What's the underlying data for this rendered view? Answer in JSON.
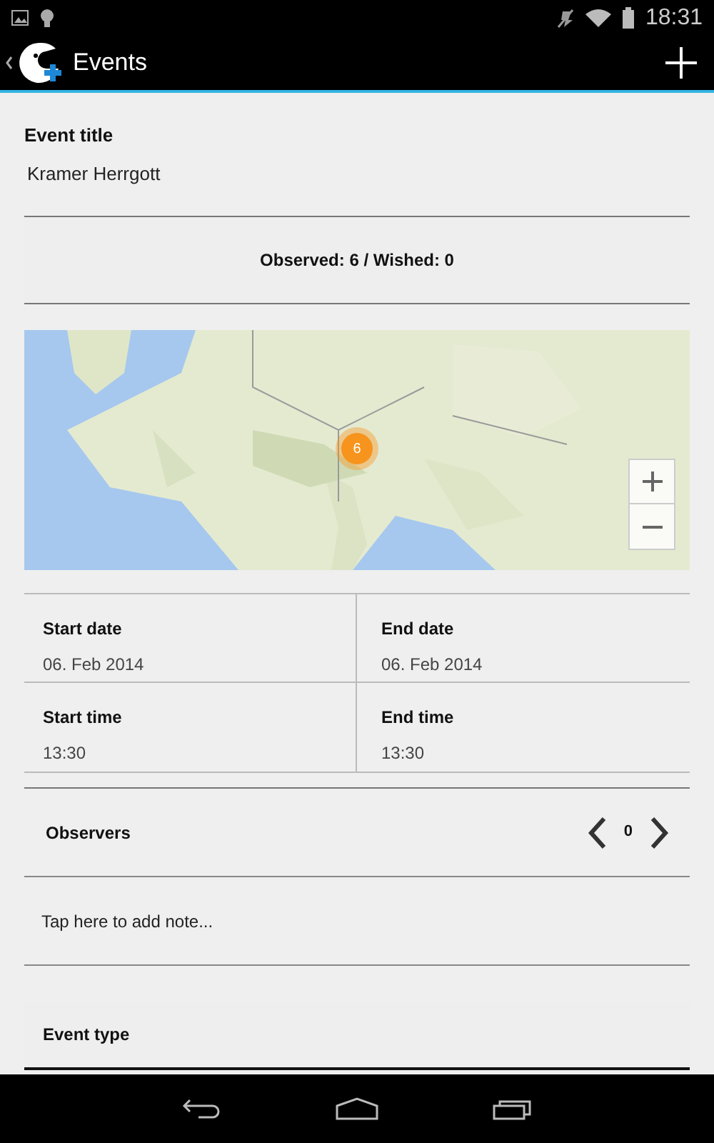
{
  "status_bar": {
    "time": "18:31"
  },
  "action_bar": {
    "title": "Events"
  },
  "event_title": {
    "label": "Event title",
    "value": "Kramer Herrgott"
  },
  "summary": "Observed: 6 / Wished: 0",
  "map": {
    "cluster_count": "6"
  },
  "dates": [
    {
      "label": "Start date",
      "value": "06. Feb 2014"
    },
    {
      "label": "End date",
      "value": "06. Feb 2014"
    },
    {
      "label": "Start time",
      "value": "13:30"
    },
    {
      "label": "End time",
      "value": "13:30"
    }
  ],
  "observers": {
    "label": "Observers",
    "count": "0"
  },
  "note": {
    "placeholder": "Tap here to add note..."
  },
  "event_type": {
    "label": "Event type"
  }
}
